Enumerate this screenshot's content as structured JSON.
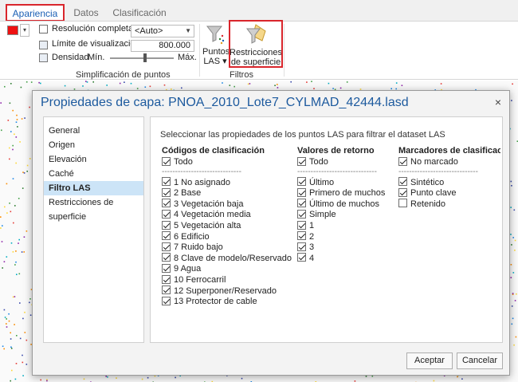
{
  "ribbon": {
    "tabs": [
      {
        "label": "Apariencia",
        "active": true
      },
      {
        "label": "Datos",
        "active": false
      },
      {
        "label": "Clasificación",
        "active": false
      }
    ],
    "color_swatch": "#ee1111",
    "resolucion_label": "Resolución completa",
    "limite_label": "Límite de visualización",
    "limite_combo_value": "<Auto>",
    "limite_number": "800.000",
    "densidad_label": "Densidad",
    "densidad_min": "Mín.",
    "densidad_max": "Máx.",
    "densidad_level": 0.55,
    "simplificacion_group": "Simplificación de puntos",
    "filtros_group": "Filtros",
    "puntos_las_label1": "Puntos",
    "puntos_las_label2": "LAS ▾",
    "restricciones_label1": "Restricciones",
    "restricciones_label2": "de superficie"
  },
  "dialog": {
    "title": "Propiedades de capa: PNOA_2010_Lote7_CYLMAD_42444.lasd",
    "close": "×",
    "nav": [
      {
        "label": "General",
        "selected": false
      },
      {
        "label": "Origen",
        "selected": false
      },
      {
        "label": "Elevación",
        "selected": false
      },
      {
        "label": "Caché",
        "selected": false
      },
      {
        "label": "Filtro LAS",
        "selected": true
      },
      {
        "label": "Restricciones de superficie",
        "selected": false
      }
    ],
    "intro": "Seleccionar las propiedades de los puntos LAS para filtrar el dataset LAS",
    "classification": {
      "header": "Códigos de clasificación",
      "all_label": "Todo",
      "divider": "------------------------------",
      "items": [
        {
          "label": "1 No asignado",
          "checked": true
        },
        {
          "label": "2 Base",
          "checked": true
        },
        {
          "label": "3 Vegetación baja",
          "checked": true
        },
        {
          "label": "4 Vegetación media",
          "checked": true
        },
        {
          "label": "5 Vegetación alta",
          "checked": true
        },
        {
          "label": "6 Edificio",
          "checked": true
        },
        {
          "label": "7 Ruido bajo",
          "checked": true
        },
        {
          "label": "8 Clave de modelo/Reservado",
          "checked": true
        },
        {
          "label": "9 Agua",
          "checked": true
        },
        {
          "label": "10 Ferrocarril",
          "checked": true
        },
        {
          "label": "12 Superponer/Reservado",
          "checked": true
        },
        {
          "label": "13 Protector de cable",
          "checked": true
        }
      ]
    },
    "returns": {
      "header": "Valores de retorno",
      "all_label": "Todo",
      "divider": "------------------------------",
      "items": [
        {
          "label": "Último",
          "checked": true
        },
        {
          "label": "Primero de muchos",
          "checked": true
        },
        {
          "label": "Último de muchos",
          "checked": true
        },
        {
          "label": "Simple",
          "checked": true
        },
        {
          "label": "1",
          "checked": true
        },
        {
          "label": "2",
          "checked": true
        },
        {
          "label": "3",
          "checked": true
        },
        {
          "label": "4",
          "checked": true
        }
      ]
    },
    "flags": {
      "header": "Marcadores de clasificaci",
      "all_label": "No marcado",
      "divider": "------------------------------",
      "items": [
        {
          "label": "Sintético",
          "checked": true
        },
        {
          "label": "Punto clave",
          "checked": true
        },
        {
          "label": "Retenido",
          "checked": false
        }
      ]
    },
    "ok_button": "Aceptar",
    "cancel_button": "Cancelar"
  }
}
